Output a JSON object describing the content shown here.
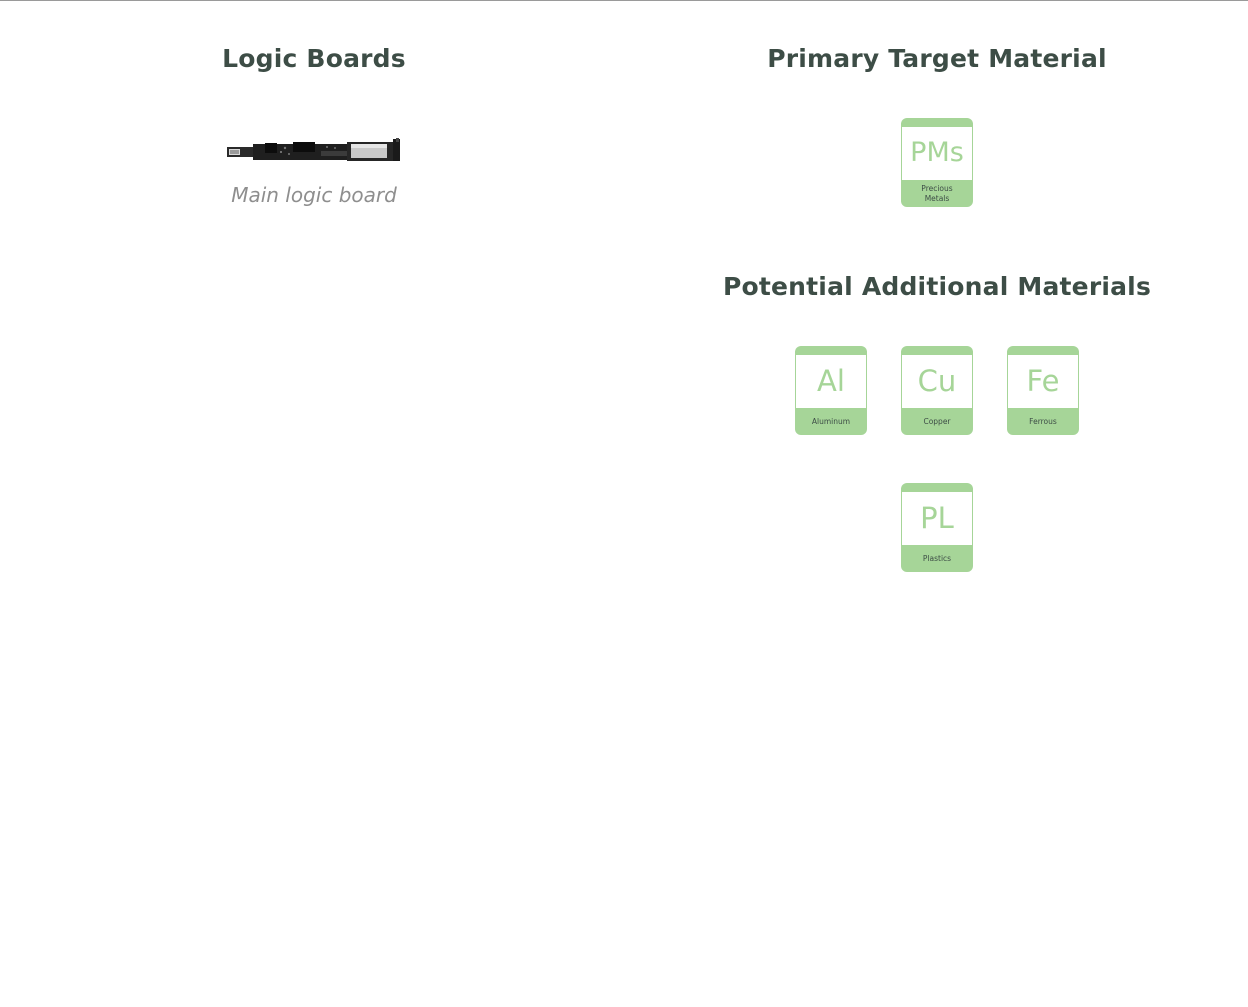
{
  "logic_boards": {
    "heading": "Logic Boards",
    "image_icon": "logic-board-image",
    "caption": "Main logic board"
  },
  "primary": {
    "heading": "Primary Target Material",
    "tiles": [
      {
        "symbol": "PMs",
        "label": "Precious Metals"
      }
    ]
  },
  "additional": {
    "heading": "Potential Additional Materials",
    "tiles": [
      {
        "symbol": "Al",
        "label": "Aluminum"
      },
      {
        "symbol": "Cu",
        "label": "Copper"
      },
      {
        "symbol": "Fe",
        "label": "Ferrous"
      },
      {
        "symbol": "PL",
        "label": "Plastics"
      }
    ]
  },
  "colors": {
    "heading": "#3d4d46",
    "tile_green": "#a6d598",
    "caption": "#8e8e8e"
  }
}
